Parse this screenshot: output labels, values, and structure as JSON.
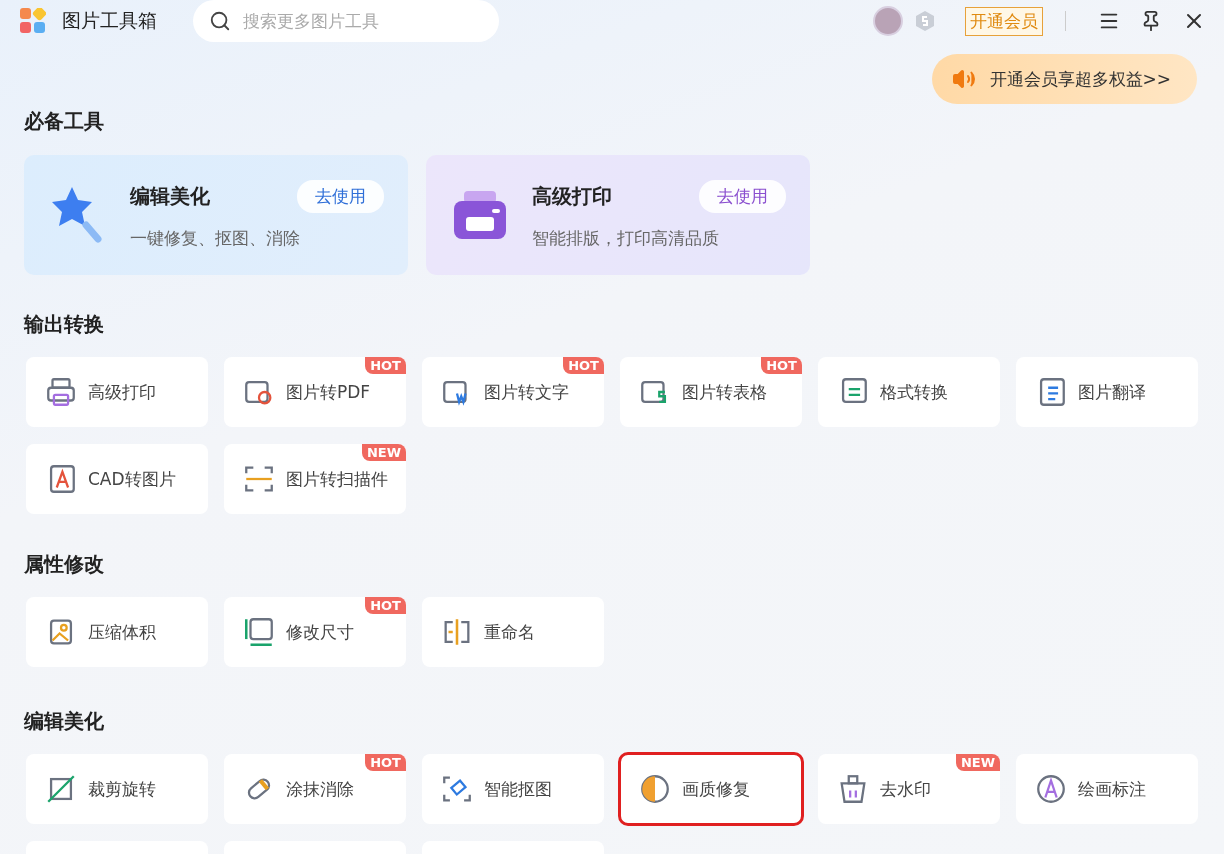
{
  "app": {
    "title": "图片工具箱"
  },
  "search": {
    "placeholder": "搜索更多图片工具"
  },
  "vip_button": "开通会员",
  "promo": "开通会员享超多权益>>",
  "featured": {
    "title": "必备工具",
    "cards": [
      {
        "title": "编辑美化",
        "subtitle": "一键修复、抠图、消除",
        "action": "去使用",
        "kind": "edit"
      },
      {
        "title": "高级打印",
        "subtitle": "智能排版，打印高清品质",
        "action": "去使用",
        "kind": "print"
      }
    ]
  },
  "sections": [
    {
      "title": "输出转换",
      "tiles": [
        {
          "kind": "tool",
          "label": "高级打印",
          "highlighted": false
        },
        {
          "kind": "tool",
          "label": "图片转PDF",
          "badge": "HOT",
          "highlighted": false
        },
        {
          "kind": "tool",
          "label": "图片转文字",
          "badge": "HOT",
          "highlighted": false
        },
        {
          "kind": "tool",
          "label": "图片转表格",
          "badge": "HOT",
          "highlighted": false
        },
        {
          "kind": "tool",
          "label": "格式转换",
          "highlighted": false
        },
        {
          "kind": "tool",
          "label": "图片翻译",
          "highlighted": false
        },
        {
          "kind": "tool",
          "label": "CAD转图片",
          "highlighted": false
        },
        {
          "kind": "tool",
          "label": "图片转扫描件",
          "badge": "NEW",
          "highlighted": false
        }
      ]
    },
    {
      "title": "属性修改",
      "tiles": [
        {
          "kind": "tool",
          "label": "压缩体积",
          "highlighted": false
        },
        {
          "kind": "tool",
          "label": "修改尺寸",
          "badge": "HOT",
          "highlighted": false
        },
        {
          "kind": "tool",
          "label": "重命名",
          "highlighted": false
        }
      ]
    },
    {
      "title": "编辑美化",
      "tiles": [
        {
          "kind": "tool",
          "label": "裁剪旋转",
          "highlighted": false
        },
        {
          "kind": "tool",
          "label": "涂抹消除",
          "badge": "HOT",
          "highlighted": false
        },
        {
          "kind": "tool",
          "label": "智能抠图",
          "highlighted": false
        },
        {
          "kind": "tool",
          "label": "画质修复",
          "highlighted": true
        },
        {
          "kind": "tool",
          "label": "去水印",
          "badge": "NEW",
          "highlighted": false
        },
        {
          "kind": "tool",
          "label": "绘画标注",
          "highlighted": false
        },
        {
          "kind": "cut"
        },
        {
          "kind": "cut"
        },
        {
          "kind": "cut"
        }
      ]
    }
  ]
}
